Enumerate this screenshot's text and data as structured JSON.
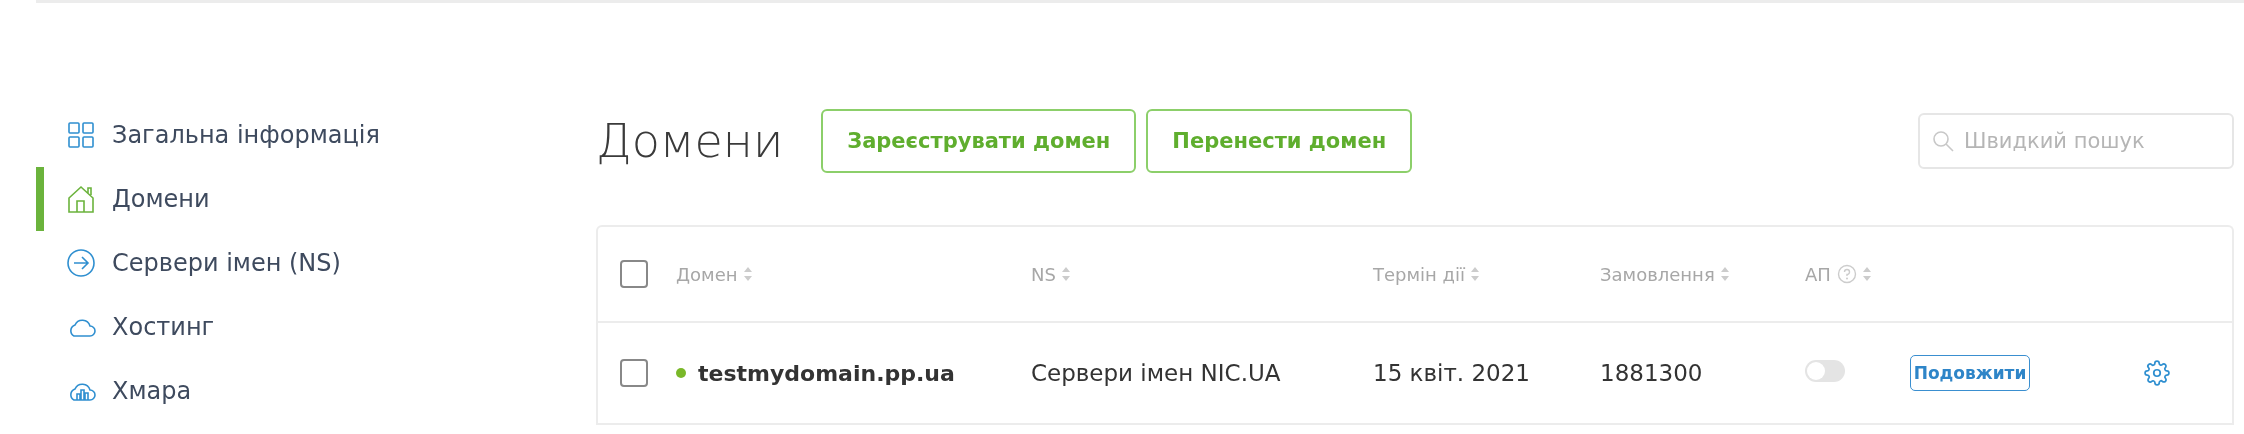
{
  "sidebar": {
    "items": [
      {
        "label": "Загальна інформація",
        "kind": "grid",
        "selected": false
      },
      {
        "label": "Домени",
        "kind": "house",
        "selected": true
      },
      {
        "label": "Сервери імен (NS)",
        "kind": "arrow",
        "selected": false
      },
      {
        "label": "Хостинг",
        "kind": "cloud",
        "selected": false
      },
      {
        "label": "Хмара",
        "kind": "cloudbars",
        "selected": false
      }
    ]
  },
  "header": {
    "title": "Домени",
    "buttons": [
      "Зареєструвати домен",
      "Перенести домен"
    ],
    "search": {
      "placeholder": "Швидкий пошук"
    }
  },
  "table": {
    "select_all": {
      "checked": false
    },
    "columns": [
      {
        "label": "Домен",
        "help": false
      },
      {
        "label": "NS",
        "help": false
      },
      {
        "label": "Термін дії",
        "help": false
      },
      {
        "label": "Замовлення",
        "help": false
      },
      {
        "label": "АП",
        "help": true
      }
    ],
    "rows": [
      {
        "checked": false,
        "color": "#7ab829",
        "domain": "testmydomain.pp.ua",
        "ns": "Сервери імен NIC.UA",
        "expires": "15 квіт. 2021",
        "order": "1881300",
        "autorenew": false,
        "action": "Подовжити"
      }
    ]
  }
}
